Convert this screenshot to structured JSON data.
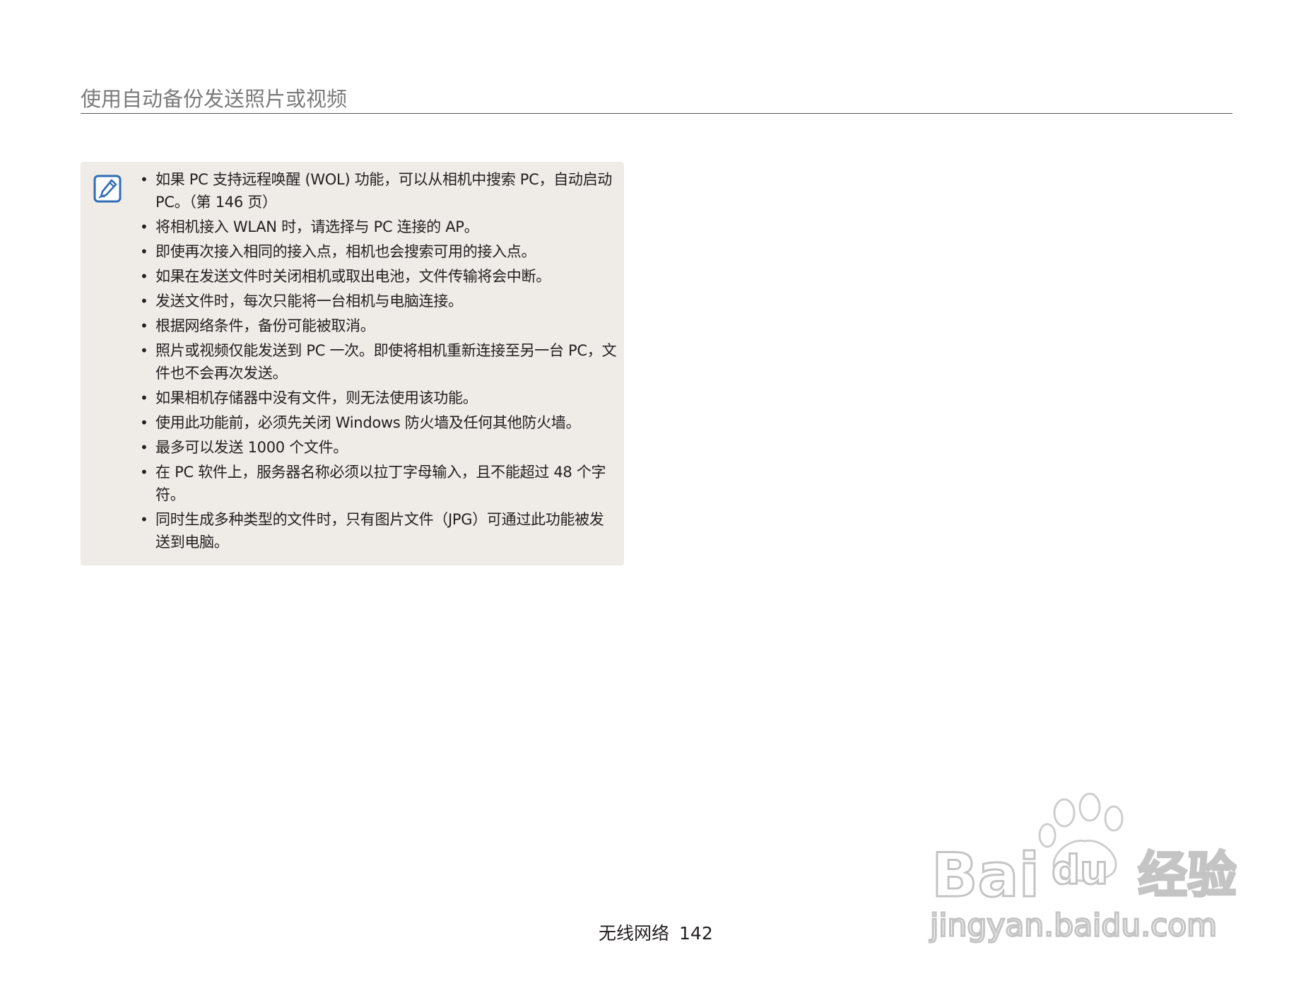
{
  "header": {
    "title": "使用自动备份发送照片或视频"
  },
  "note": {
    "icon": "note-pencil-icon",
    "items": [
      "如果 PC 支持远程唤醒 (WOL) 功能，可以从相机中搜索 PC，自动启动 PC。（第 146 页）",
      "将相机接入 WLAN 时，请选择与 PC 连接的 AP。",
      "即使再次接入相同的接入点，相机也会搜索可用的接入点。",
      "如果在发送文件时关闭相机或取出电池，文件传输将会中断。",
      "发送文件时，每次只能将一台相机与电脑连接。",
      "根据网络条件，备份可能被取消。",
      "照片或视频仅能发送到 PC 一次。即使将相机重新连接至另一台 PC，文件也不会再次发送。",
      "如果相机存储器中没有文件，则无法使用该功能。",
      "使用此功能前，必须先关闭 Windows 防火墙及任何其他防火墙。",
      "最多可以发送 1000 个文件。",
      "在 PC 软件上，服务器名称必须以拉丁字母输入，且不能超过 48 个字符。",
      "同时生成多种类型的文件时，只有图片文件（JPG）可通过此功能被发送到电脑。"
    ]
  },
  "footer": {
    "section": "无线网络",
    "page_number": "142"
  },
  "watermark": {
    "brand": "Baidu经验",
    "url": "jingyan.baidu.com"
  },
  "colors": {
    "note_background": "#efebe6",
    "icon_blue": "#2f6db5",
    "title_gray": "#7a7a7a"
  }
}
